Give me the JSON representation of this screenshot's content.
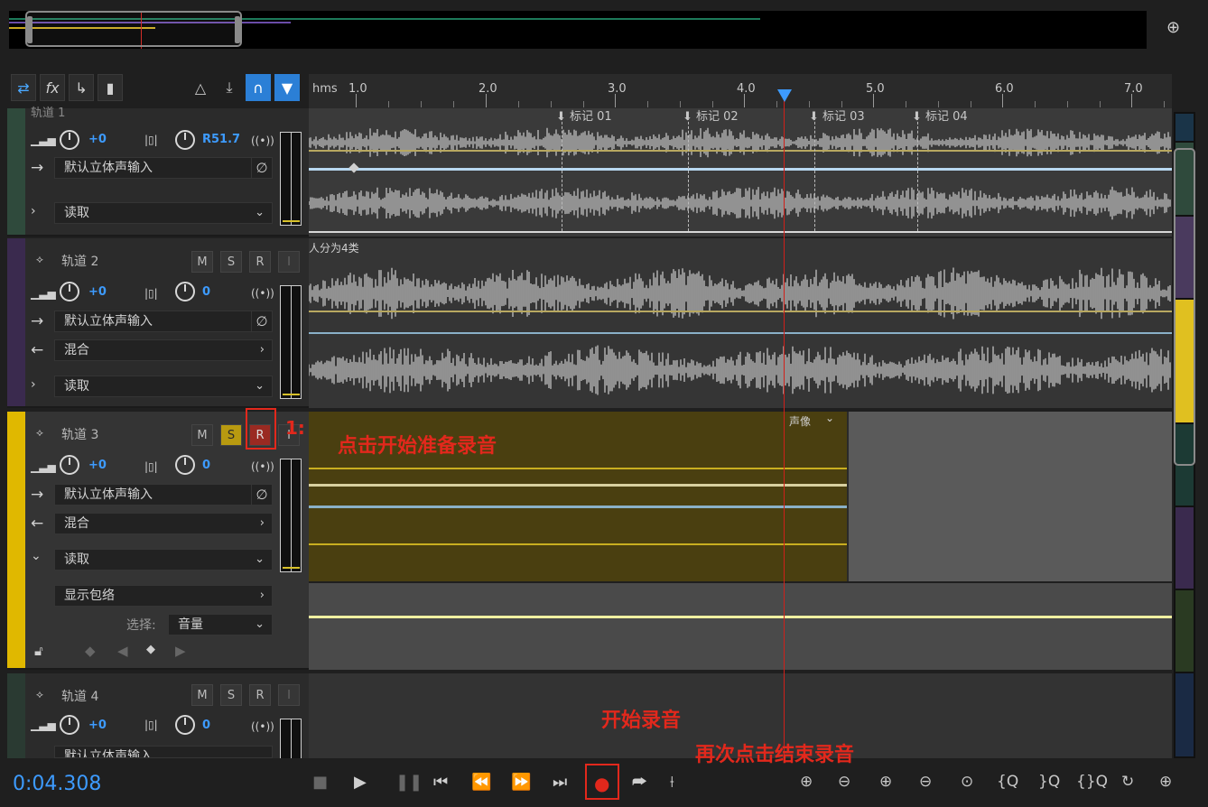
{
  "toolbar": {
    "icons": [
      "swap-icon",
      "fx-icon",
      "send-icon",
      "meter-icon",
      "metronome-icon",
      "record-arm-icon",
      "headphones-icon",
      "marker-pin-icon"
    ]
  },
  "ruler": {
    "unit": "hms",
    "ticks": [
      "1.0",
      "2.0",
      "3.0",
      "4.0",
      "5.0",
      "6.0",
      "7.0"
    ]
  },
  "markers": [
    "标记 01",
    "标记 02",
    "标记 03",
    "标记 04"
  ],
  "tracks": [
    {
      "name": "轨道 1",
      "volume": "+0",
      "pan": "R51.7",
      "input": "默认立体声输入",
      "automation": "读取",
      "color": "#2f4a3c"
    },
    {
      "name": "轨道 2",
      "volume": "+0",
      "pan": "0",
      "input": "默认立体声输入",
      "output": "混合",
      "automation": "读取",
      "color": "#3a2a4e",
      "clip_label": "人分为4类"
    },
    {
      "name": "轨道 3",
      "volume": "+0",
      "pan": "0",
      "input": "默认立体声输入",
      "output": "混合",
      "automation": "读取",
      "show_envelope": "显示包络",
      "select_label": "选择:",
      "select_value": "音量",
      "color": "#e0b800",
      "clip_label": "声像"
    },
    {
      "name": "轨道 4",
      "volume": "+0",
      "pan": "0",
      "input": "默认立体声输入",
      "color": "#2a3a32"
    }
  ],
  "buttons": {
    "mute": "M",
    "solo": "S",
    "record": "R",
    "input": "I"
  },
  "transport": {
    "time": "0:04.308"
  },
  "annotations": {
    "step1_num": "1:",
    "step1": "点击开始准备录音",
    "start": "开始录音",
    "stop": "再次点击结束录音"
  },
  "colors": {
    "accent_blue": "#3d9bff",
    "annotation_red": "#e2281c",
    "track3_yellow": "#e0b800",
    "playhead": "#d0201a"
  }
}
